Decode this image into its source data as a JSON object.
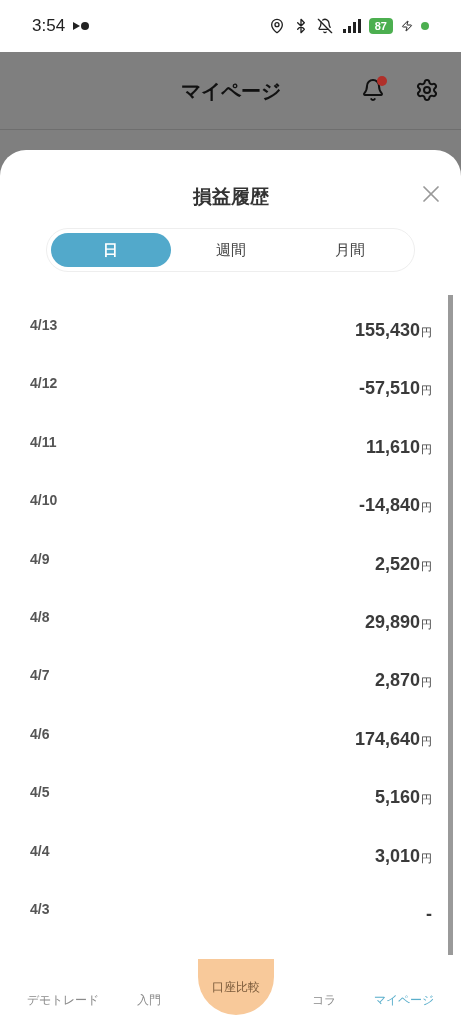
{
  "status_bar": {
    "time": "3:54",
    "battery": "87"
  },
  "header": {
    "title": "マイページ",
    "notification": true
  },
  "sheet": {
    "title": "損益履歴",
    "tabs": [
      {
        "label": "日",
        "selected": true
      },
      {
        "label": "週間",
        "selected": false
      },
      {
        "label": "月間",
        "selected": false
      }
    ],
    "rows": [
      {
        "date": "4/13",
        "amount": "155,430",
        "unit": "円"
      },
      {
        "date": "4/12",
        "amount": "-57,510",
        "unit": "円"
      },
      {
        "date": "4/11",
        "amount": "11,610",
        "unit": "円"
      },
      {
        "date": "4/10",
        "amount": "-14,840",
        "unit": "円"
      },
      {
        "date": "4/9",
        "amount": "2,520",
        "unit": "円"
      },
      {
        "date": "4/8",
        "amount": "29,890",
        "unit": "円"
      },
      {
        "date": "4/7",
        "amount": "2,870",
        "unit": "円"
      },
      {
        "date": "4/6",
        "amount": "174,640",
        "unit": "円"
      },
      {
        "date": "4/5",
        "amount": "5,160",
        "unit": "円"
      },
      {
        "date": "4/4",
        "amount": "3,010",
        "unit": "円"
      },
      {
        "date": "4/3",
        "amount": "-"
      }
    ]
  },
  "bottom_nav": [
    {
      "label": "デモトレード",
      "selected": false
    },
    {
      "label": "入門",
      "selected": false
    },
    {
      "label": "口座比較",
      "selected": false,
      "kind": "center"
    },
    {
      "label": "コラ",
      "selected": false
    },
    {
      "label": "マイページ",
      "selected": true
    }
  ]
}
